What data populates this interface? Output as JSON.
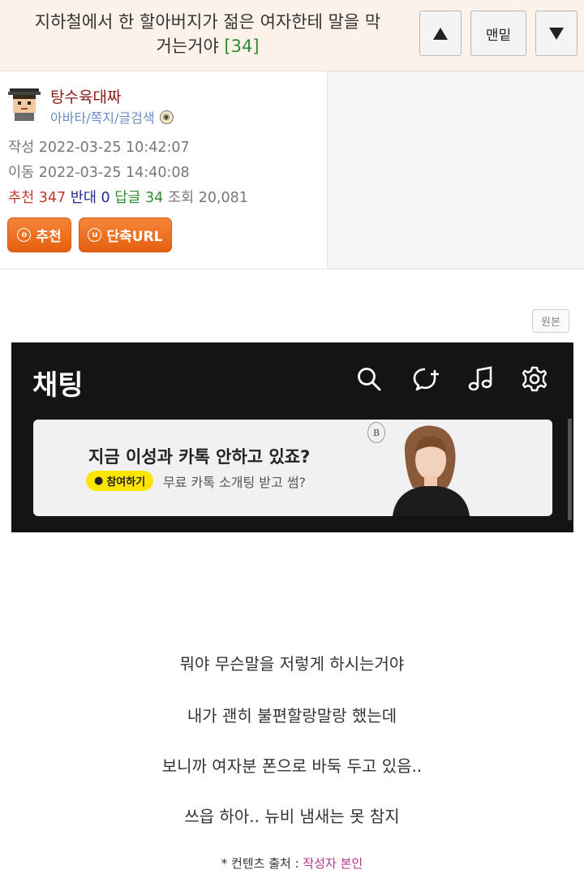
{
  "header": {
    "title_line1": "지하철에서 한 할아버지가 젊은 여자한테 말을 막",
    "title_line2": "거는거야",
    "comment_count": "[34]",
    "bottom_button": "맨밑"
  },
  "author": {
    "nickname": "탕수육대짜",
    "links": "아바타/쪽지/글검색",
    "created_label": "작성",
    "created": "2022-03-25 10:42:07",
    "moved_label": "이동",
    "moved": "2022-03-25 14:40:08",
    "recommend_label": "추천",
    "recommend": "347",
    "oppose_label": "반대",
    "oppose": "0",
    "reply_label": "답글",
    "reply": "34",
    "views_label": "조회",
    "views": "20,081",
    "recommend_button": "추천",
    "short_url_button": "단축URL"
  },
  "original_button": "원본",
  "screenshot": {
    "title": "채팅",
    "ad_headline": "지금 이성과 카톡 안하고 있죠?",
    "ad_pill": "참여하기",
    "ad_sub": "무료 카톡 소개팅 받고 썸?",
    "ad_logo": "B",
    "icons": [
      "search-icon",
      "new-chat-icon",
      "music-icon",
      "settings-icon"
    ]
  },
  "content": {
    "lines": [
      "뭐야  무슨말을 저렇게 하시는거야",
      "내가 괜히 불편할랑말랑 했는데",
      "보니까 여자분 폰으로 바둑 두고 있음..",
      "쓰읍 하아.. 뉴비 냄새는 못 참지"
    ],
    "source_prefix": "* 컨텐츠 출처 : ",
    "source_value": "작성자 본인"
  },
  "colors": {
    "header_bg": "#fdf2e9",
    "nickname": "#8b1a1a",
    "recommend": "#c0392b",
    "oppose": "#1d2a8f",
    "reply": "#2e8b2e",
    "button_orange": "#e55f0f",
    "kakao_yellow": "#fee500",
    "source_pink": "#b5338a"
  }
}
